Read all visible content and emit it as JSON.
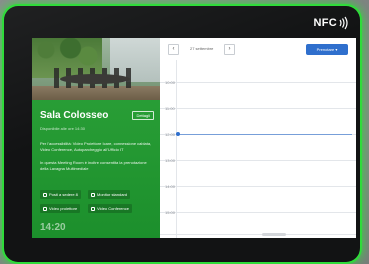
{
  "device": {
    "nfc_label": "NFC"
  },
  "room": {
    "name": "Sala Colosseo",
    "subtitle": "Disponibile alle ore 14:30",
    "details_label": "Dettagli",
    "description_1": "Per l'accessibilità: Video Proiettore Icare, connessione cablata, Video Conference, Autoparcheggio all'Ufficio IT",
    "description_2": "In questa Meeting Room è inoltre consentita la prenotazione della Lavagna Multimediale",
    "features": [
      {
        "label": "Posti a sedere 8",
        "icon": "chair-icon"
      },
      {
        "label": "Monitor standard",
        "icon": "monitor-icon"
      },
      {
        "label": "Video proiettore",
        "icon": "projector-icon"
      },
      {
        "label": "Video Conference",
        "icon": "camera-icon"
      }
    ],
    "clock": "14:20"
  },
  "calendar": {
    "date": "27 settembre",
    "book_label": "Prenotare ▾",
    "hours": [
      "10:00",
      "11:00",
      "12:00",
      "13:00",
      "14:00",
      "15:00",
      "16:00"
    ]
  },
  "colors": {
    "accent_green": "#2ea43a",
    "accent_blue": "#2f6fcd"
  }
}
